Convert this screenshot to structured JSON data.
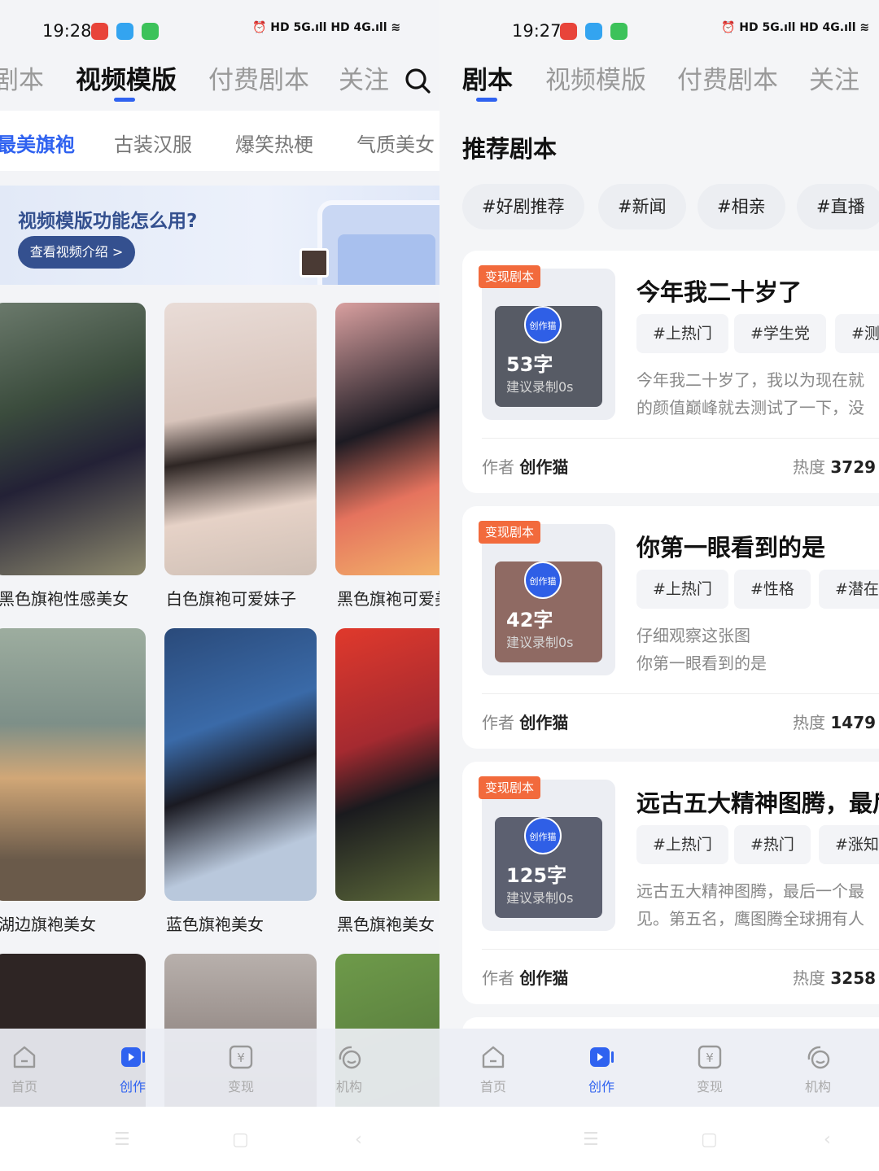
{
  "left": {
    "status": {
      "time": "19:28",
      "right": "⏰ HD 5G.ıll HD 4G.ıll ≋"
    },
    "tabs": [
      "剧本",
      "视频模版",
      "付费剧本",
      "关注"
    ],
    "categories": [
      "最美旗袍",
      "古装汉服",
      "爆笑热梗",
      "气质美女"
    ],
    "banner": {
      "title": "视频模版功能怎么用?",
      "button": "查看视频介绍 >"
    },
    "cards": [
      {
        "label": "黑色旗袍性感美女"
      },
      {
        "label": "白色旗袍可爱妹子"
      },
      {
        "label": "黑色旗袍可爱美"
      },
      {
        "label": "湖边旗袍美女"
      },
      {
        "label": "蓝色旗袍美女"
      },
      {
        "label": "黑色旗袍美女"
      }
    ],
    "bottom_nav": [
      "首页",
      "创作",
      "变现",
      "机构"
    ]
  },
  "right": {
    "status": {
      "time": "19:27",
      "right": "⏰ HD 5G.ıll HD 4G.ıll ≋"
    },
    "tabs": [
      "剧本",
      "视频模版",
      "付费剧本",
      "关注"
    ],
    "section_title": "推荐剧本",
    "chips": [
      "#好剧推荐",
      "#新闻",
      "#相亲",
      "#直播"
    ],
    "scripts": [
      {
        "badge": "变现剧本",
        "logo": "创作猫",
        "count": "53字",
        "hint": "建议录制0s",
        "title": "今年我二十岁了",
        "tags": [
          "#上热门",
          "#学生党",
          "#测试"
        ],
        "desc1": "今年我二十岁了，我以为现在就",
        "desc2": "的颜值巅峰就去测试了一下，没",
        "author_label": "作者",
        "author": "创作猫",
        "heat_label": "热度",
        "heat": "3729"
      },
      {
        "badge": "变现剧本",
        "logo": "创作猫",
        "count": "42字",
        "hint": "建议录制0s",
        "title": "你第一眼看到的是",
        "tags": [
          "#上热门",
          "#性格",
          "#潜在性"
        ],
        "desc1": "仔细观察这张图",
        "desc2": "你第一眼看到的是",
        "author_label": "作者",
        "author": "创作猫",
        "heat_label": "热度",
        "heat": "1479"
      },
      {
        "badge": "变现剧本",
        "logo": "创作猫",
        "count": "125字",
        "hint": "建议录制0s",
        "title": "远古五大精神图腾，最后",
        "tags": [
          "#上热门",
          "#热门",
          "#涨知识"
        ],
        "desc1": "远古五大精神图腾，最后一个最",
        "desc2": "见。第五名，鹰图腾全球拥有人",
        "author_label": "作者",
        "author": "创作猫",
        "heat_label": "热度",
        "heat": "3258"
      }
    ],
    "bottom_nav": [
      "首页",
      "创作",
      "变现",
      "机构"
    ]
  },
  "colors": {
    "accent": "#2f62f0",
    "badge": "#f26a3c",
    "banner_text": "#34508f"
  }
}
